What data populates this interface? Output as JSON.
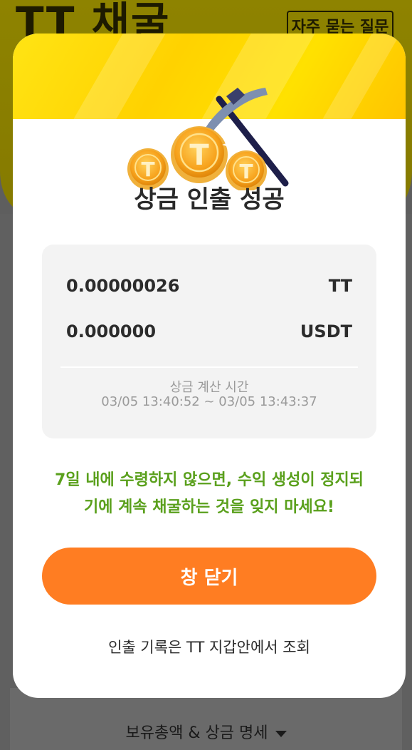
{
  "background": {
    "title": "TT 채굴",
    "faq_button": "자주 묻는 질문",
    "summary_label": "보유총액 & 상금 명세"
  },
  "modal": {
    "title": "상금 인출 성공",
    "coin_letter": "T",
    "rows": [
      {
        "amount": "0.00000026",
        "unit": "TT"
      },
      {
        "amount": "0.000000",
        "unit": "USDT"
      }
    ],
    "calc_label": "상금 계산 시간",
    "calc_time": "03/05 13:40:52 ~ 03/05 13:43:37",
    "warning_line1": "7일 내에 수령하지 않으면, 수익 생성이 정지되",
    "warning_line2": "기에 계속 채굴하는 것을 잊지 마세요!",
    "close_button": "창 닫기",
    "history_link": "인출 기록은 TT 지갑안에서 조회"
  },
  "colors": {
    "banner": "#ffd600",
    "button": "#ff7d22",
    "warning": "#5aa01c",
    "coin": "#f7a21c"
  }
}
